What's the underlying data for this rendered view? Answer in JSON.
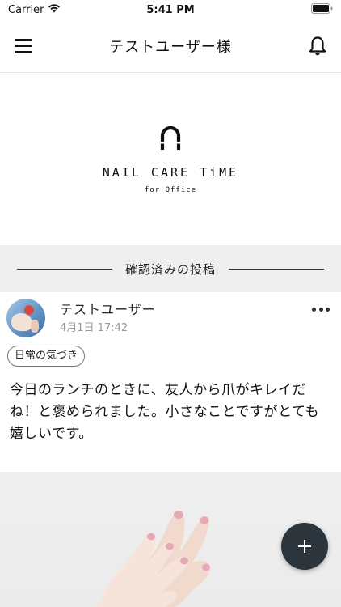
{
  "status_bar": {
    "carrier": "Carrier",
    "time": "5:41 PM"
  },
  "nav": {
    "title": "テストユーザー様",
    "menu_icon": "hamburger-menu-icon",
    "bell_icon": "bell-icon"
  },
  "brand": {
    "name": "NAIL CARE TiME",
    "sub": "for Office"
  },
  "section": {
    "title": "確認済みの投稿"
  },
  "post": {
    "user": "テストユーザー",
    "date": "4月1日 17:42",
    "tag": "日常の気づき",
    "body": "今日のランチのときに、友人から爪がキレイだね！と褒められました。小さなことですがとても嬉しいです。"
  },
  "fab": {
    "icon": "plus-icon"
  }
}
